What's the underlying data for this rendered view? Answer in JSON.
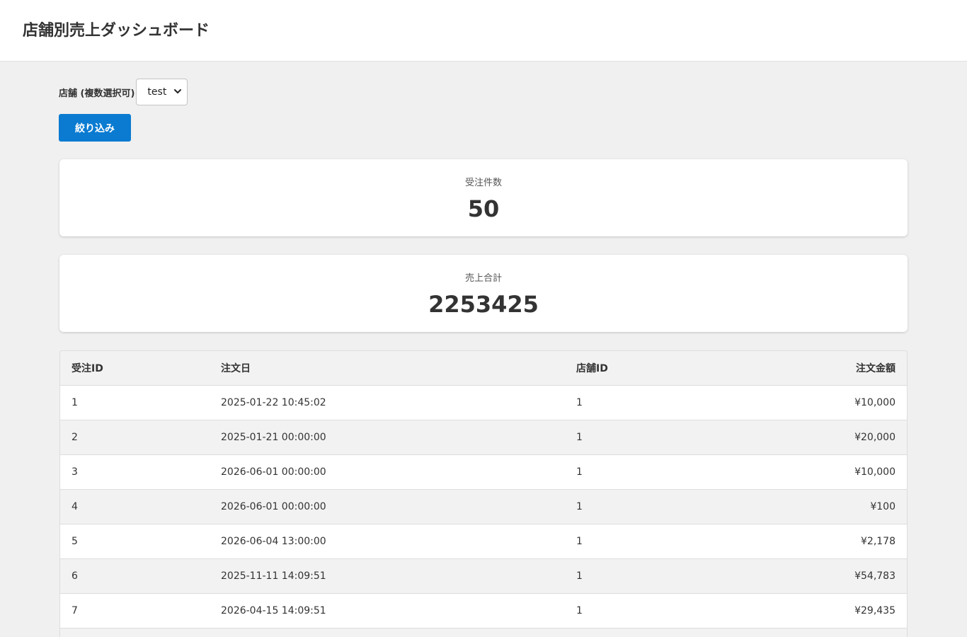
{
  "header": {
    "title": "店舗別売上ダッシュボード"
  },
  "filter": {
    "label": "店舗 (複数選択可)",
    "selected": "test",
    "button_label": "絞り込み"
  },
  "stats": {
    "order_count_label": "受注件数",
    "order_count_value": "50",
    "sales_total_label": "売上合計",
    "sales_total_value": "2253425"
  },
  "table": {
    "headers": [
      "受注ID",
      "注文日",
      "店舗ID",
      "注文金額"
    ],
    "rows": [
      [
        "1",
        "2025-01-22 10:45:02",
        "1",
        "¥10,000"
      ],
      [
        "2",
        "2025-01-21 00:00:00",
        "1",
        "¥20,000"
      ],
      [
        "3",
        "2026-06-01 00:00:00",
        "1",
        "¥10,000"
      ],
      [
        "4",
        "2026-06-01 00:00:00",
        "1",
        "¥100"
      ],
      [
        "5",
        "2026-06-04 13:00:00",
        "1",
        "¥2,178"
      ],
      [
        "6",
        "2025-11-11 14:09:51",
        "1",
        "¥54,783"
      ],
      [
        "7",
        "2026-04-15 14:09:51",
        "1",
        "¥29,435"
      ]
    ]
  },
  "colors": {
    "accent": "#0a7bd1",
    "background": "#f0f0f0"
  }
}
